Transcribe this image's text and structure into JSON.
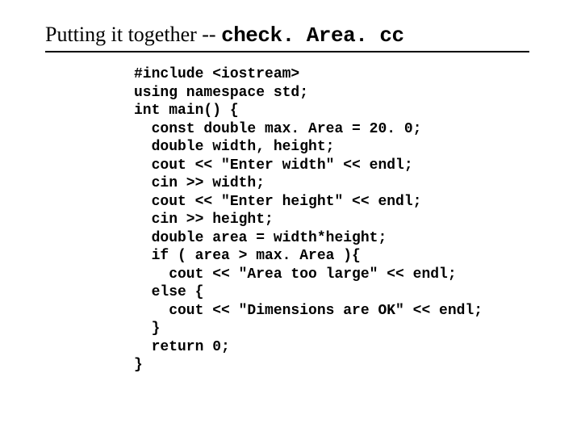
{
  "title": {
    "prefix": "Putting it together -- ",
    "mono": "check. Area. cc"
  },
  "code": "#include <iostream>\nusing namespace std;\nint main() {\n  const double max. Area = 20. 0;\n  double width, height;\n  cout << \"Enter width\" << endl;\n  cin >> width;\n  cout << \"Enter height\" << endl;\n  cin >> height;\n  double area = width*height;\n  if ( area > max. Area ){\n    cout << \"Area too large\" << endl;\n  else {\n    cout << \"Dimensions are OK\" << endl;\n  }\n  return 0;\n}"
}
